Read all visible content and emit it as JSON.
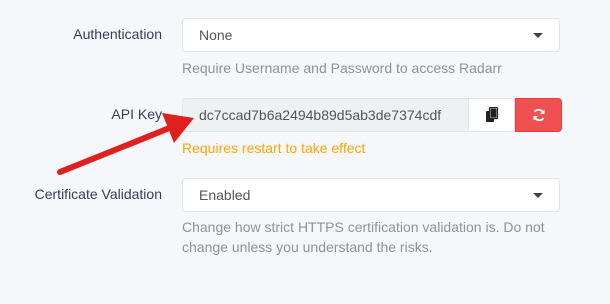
{
  "authentication": {
    "label": "Authentication",
    "value": "None",
    "help": "Require Username and Password to access Radarr"
  },
  "api_key": {
    "label": "API Key",
    "value": "dc7ccad7b6a2494b89d5ab3de7374cdf",
    "warning": "Requires restart to take effect"
  },
  "certificate_validation": {
    "label": "Certificate Validation",
    "value": "Enabled",
    "help": "Change how strict HTTPS certification validation is. Do not change unless you understand the risks."
  },
  "colors": {
    "warning": "#ffa500",
    "danger": "#f05050",
    "annotation_arrow": "#e0201e"
  },
  "icons": {
    "copy": "copy-icon",
    "regenerate": "refresh-icon",
    "dropdown": "caret-down-icon"
  }
}
